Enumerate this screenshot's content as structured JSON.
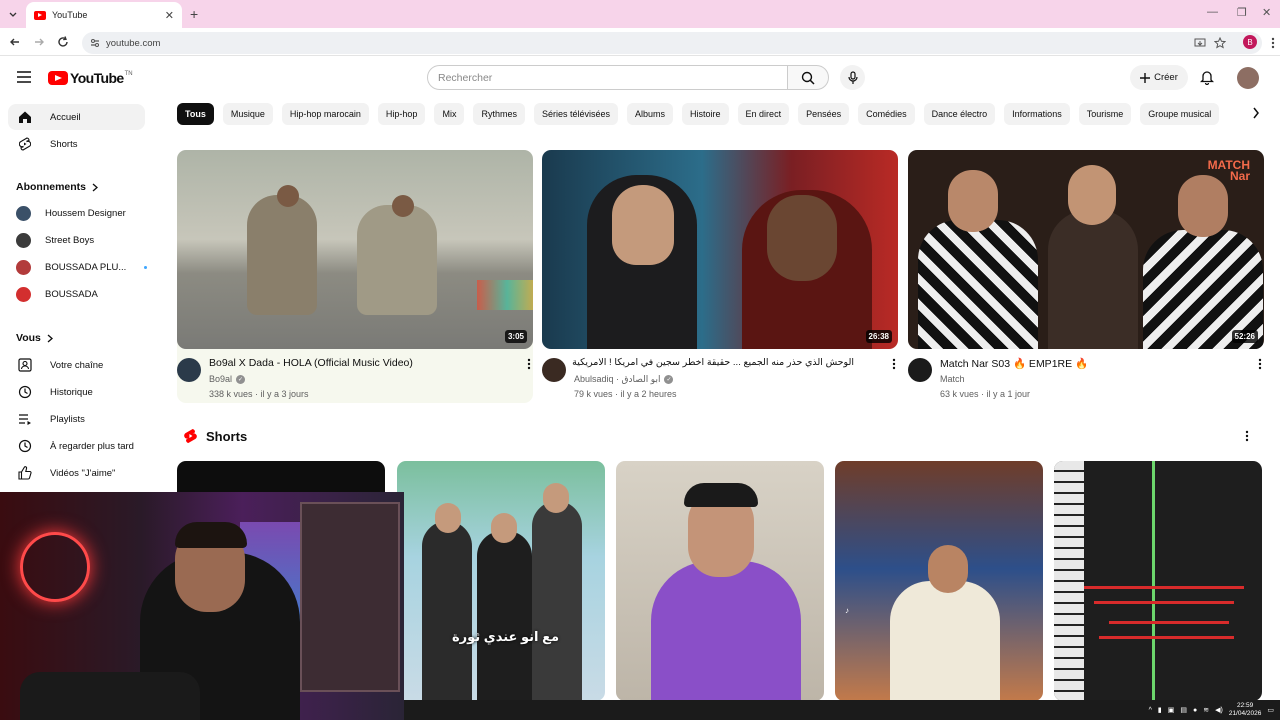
{
  "browser": {
    "tab_title": "YouTube",
    "tab_close": "✕",
    "new_tab": "+",
    "url": "youtube.com",
    "profile_initial": "B",
    "window_minimize": "—",
    "window_restore": "❐",
    "window_close": "✕"
  },
  "header": {
    "logo_text": "YouTube",
    "logo_region": "TN",
    "search_placeholder": "Rechercher",
    "create_label": "Créer"
  },
  "sidebar": {
    "main": [
      {
        "label": "Accueil",
        "icon": "home-icon"
      },
      {
        "label": "Shorts",
        "icon": "shorts-icon"
      }
    ],
    "subscriptions_heading": "Abonnements",
    "subscriptions": [
      {
        "label": "Houssem Designer",
        "color": "#3a5068"
      },
      {
        "label": "Street Boys",
        "color": "#3b3b3b"
      },
      {
        "label": "BOUSSADA PLU...",
        "color": "#b23b3b"
      },
      {
        "label": "BOUSSADA",
        "color": "#d32f2f"
      }
    ],
    "you_heading": "Vous",
    "you_items": [
      {
        "label": "Votre chaîne",
        "icon": "channel-icon"
      },
      {
        "label": "Historique",
        "icon": "history-icon"
      },
      {
        "label": "Playlists",
        "icon": "playlists-icon"
      },
      {
        "label": "À regarder plus tard",
        "icon": "watch-later-icon"
      },
      {
        "label": "Vidéos \"J'aime\"",
        "icon": "like-icon"
      }
    ]
  },
  "chips": [
    "Tous",
    "Musique",
    "Hip-hop marocain",
    "Hip-hop",
    "Mix",
    "Rythmes",
    "Séries télévisées",
    "Albums",
    "Histoire",
    "En direct",
    "Pensées",
    "Comédies",
    "Dance électro",
    "Informations",
    "Tourisme",
    "Groupe musical"
  ],
  "videos": [
    {
      "title": "Bo9al X Dada - HOLA (Official Music Video)",
      "channel": "Bo9al",
      "stats": "338 k vues · il y a 3 jours",
      "duration": "3:05"
    },
    {
      "title": "الوحش الذي حذر منه الجميع ... حقيقة اخطر سجين في امريكا ! الامريكية",
      "channel": "Abulsadiq · ابو الصادق",
      "stats": "79 k vues · il y a 2 heures",
      "duration": "26:38"
    },
    {
      "title": "Match Nar S03 🔥 EMP1RE 🔥",
      "channel": "Match",
      "stats": "63 k vues · il y a 1 jour",
      "duration": "52:26"
    }
  ],
  "shorts": {
    "heading": "Shorts",
    "caption": "مع انو عندي ثورة"
  },
  "taskbar": {
    "time": "22:59",
    "date": "21/04/2026"
  }
}
